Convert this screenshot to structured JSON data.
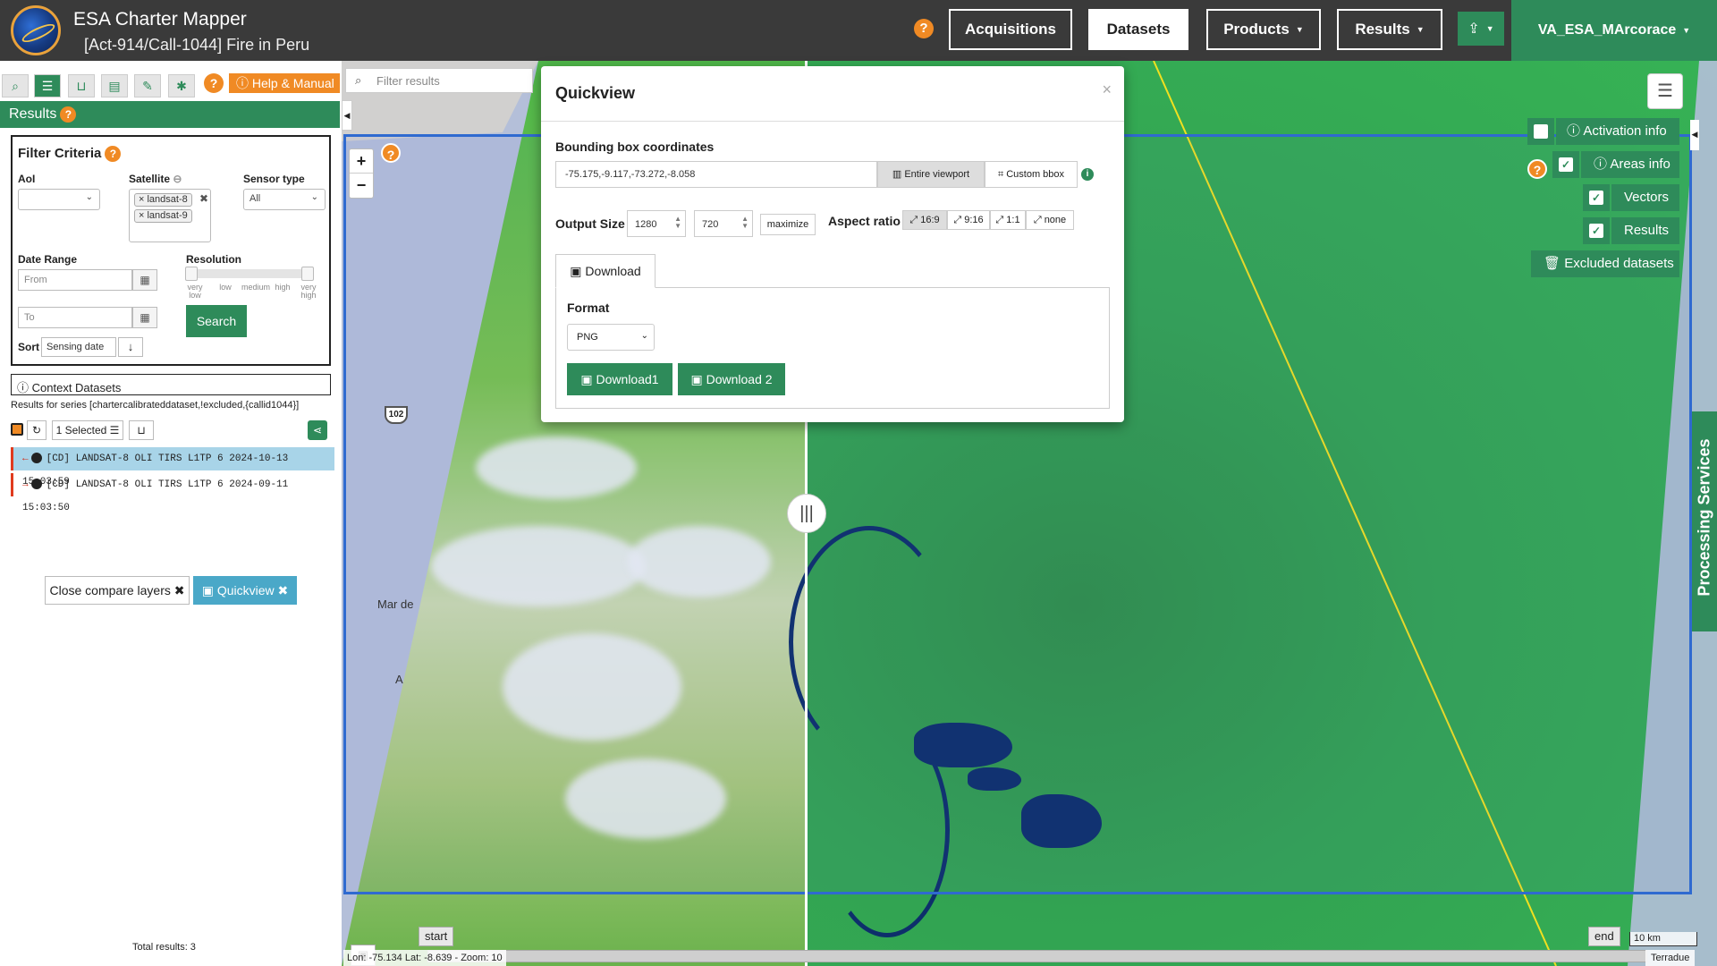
{
  "header": {
    "title": "ESA Charter Mapper",
    "subtitle": "[Act-914/Call-1044] Fire in Peru",
    "help": "?",
    "nav": [
      {
        "label": "Acquisitions",
        "dropdown": false
      },
      {
        "label": "Datasets",
        "dropdown": false
      },
      {
        "label": "Products",
        "dropdown": true
      },
      {
        "label": "Results",
        "dropdown": true
      }
    ],
    "upload_icon": "upload-icon",
    "user": "VA_ESA_MArcorace"
  },
  "toolbar": {
    "icons": [
      "search-icon",
      "list-icon",
      "basket-icon",
      "archive-icon",
      "pencil-icon",
      "gear-icon"
    ],
    "help_manual": "Help & Manual"
  },
  "results_panel": {
    "title": "Results",
    "filter": {
      "title": "Filter Criteria",
      "aoi_label": "AoI",
      "satellite_label": "Satellite",
      "satellites": [
        "landsat-8",
        "landsat-9"
      ],
      "sensor_label": "Sensor type",
      "sensor_value": "All",
      "date_range_label": "Date Range",
      "from_placeholder": "From",
      "to_placeholder": "To",
      "resolution_label": "Resolution",
      "resolution_ticks": [
        "very low",
        "low",
        "medium",
        "high",
        "very high"
      ],
      "search_label": "Search",
      "sort_label": "Sort",
      "sort_value": "Sensing date"
    },
    "context": {
      "title": "Context Datasets",
      "series_text": "Results for series [chartercalibrateddataset,!excluded,{callid1044}]",
      "selected_label": "1 Selected",
      "datasets": [
        {
          "label": "[CD] LANDSAT-8 OLI TIRS L1TP 6 2024-10-13 15:03:59",
          "arrow": "←",
          "selected": true
        },
        {
          "label": "[CD] LANDSAT-8 OLI TIRS L1TP 6 2024-09-11 15:03:50",
          "arrow": "→",
          "selected": false
        }
      ],
      "close_compare": "Close compare layers",
      "quickview": "Quickview"
    },
    "total": "Total results: 3"
  },
  "map": {
    "filter_placeholder": "Filter results",
    "zoom_in": "+",
    "zoom_out": "−",
    "labels": {
      "sea": "Mar de",
      "highway": "102",
      "a": "A"
    },
    "overlays": [
      {
        "label": "Activation info",
        "checked": false,
        "icon": "info-icon"
      },
      {
        "label": "Areas info",
        "checked": true,
        "icon": "info-icon"
      },
      {
        "label": "Vectors",
        "checked": true
      },
      {
        "label": "Results",
        "checked": true
      }
    ],
    "excluded": "Excluded datasets",
    "processing": "Processing Services",
    "timeline": {
      "start": "start",
      "end": "end"
    },
    "coords": "Lon: -75.134 Lat: -8.639 - Zoom: 10",
    "scale": "10 km",
    "attribution": "Terradue"
  },
  "quickview": {
    "title": "Quickview",
    "close": "×",
    "bbox_label": "Bounding box coordinates",
    "bbox_value": "-75.175,-9.117,-73.272,-8.058",
    "entire_viewport": "Entire viewport",
    "custom_bbox": "Custom bbox",
    "output_size_label": "Output Size",
    "width": "1280",
    "height": "720",
    "maximize": "maximize",
    "aspect_label": "Aspect ratio",
    "aspects": [
      "16:9",
      "9:16",
      "1:1",
      "none"
    ],
    "tab": "Download",
    "format_label": "Format",
    "format_value": "PNG",
    "download1": "Download1",
    "download2": "Download 2"
  },
  "colors": {
    "accent": "#2e8b5a",
    "warning": "#f08a24",
    "header": "#3a3a3a",
    "selected_row": "#a8d4e8",
    "bbox": "#2f6ad0"
  }
}
